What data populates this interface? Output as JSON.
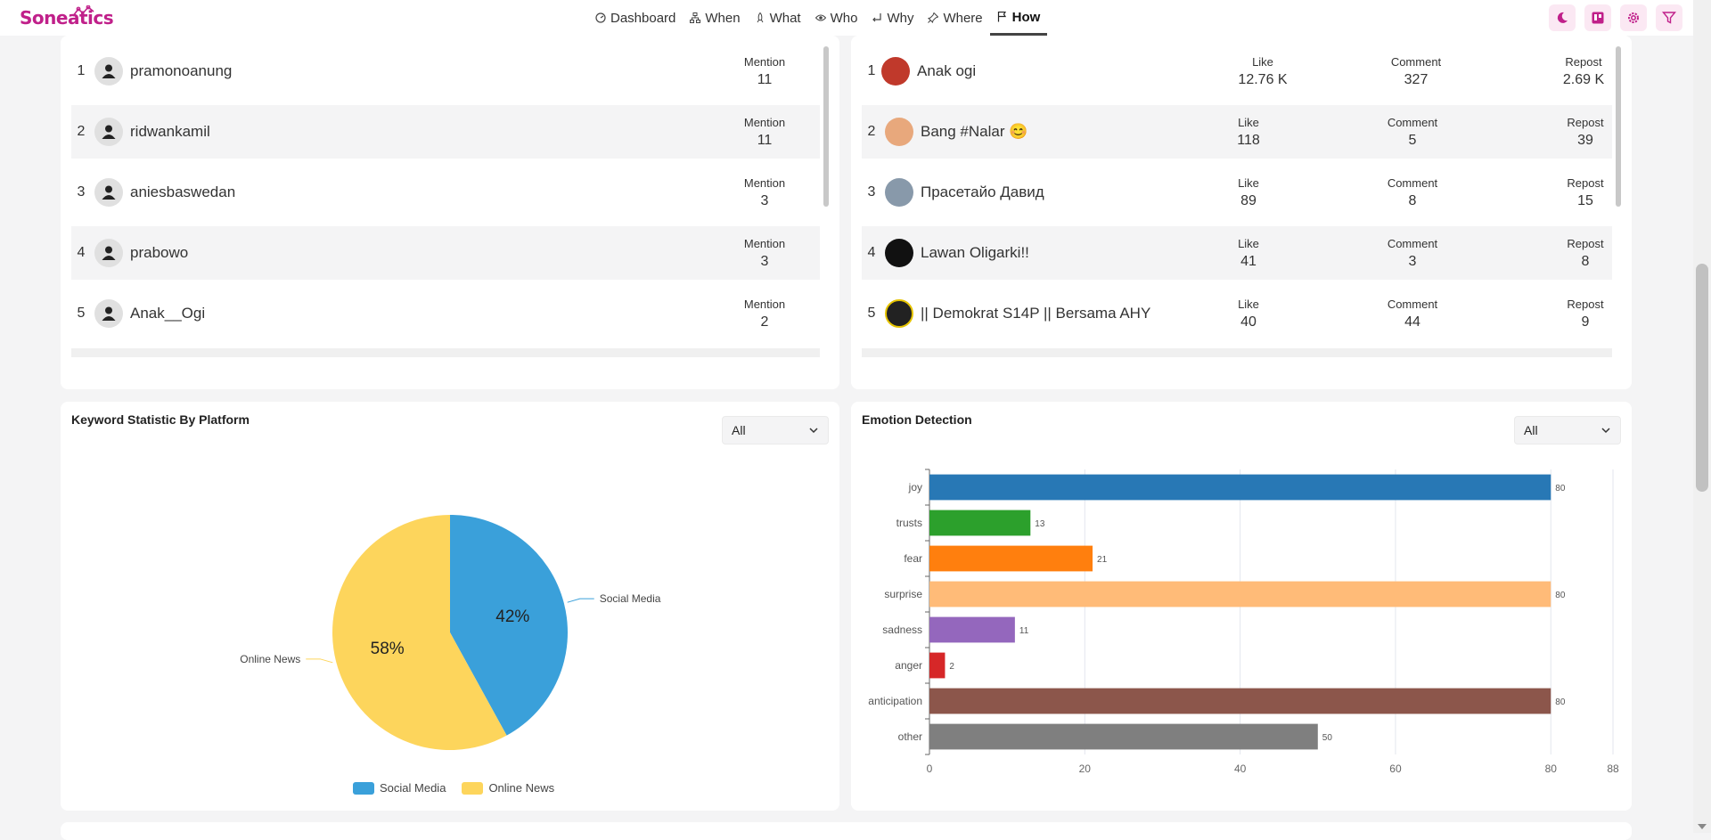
{
  "app": {
    "logo": "Soneatics"
  },
  "nav": {
    "items": [
      {
        "label": "Dashboard",
        "icon": "gauge-icon"
      },
      {
        "label": "When",
        "icon": "sitemap-icon"
      },
      {
        "label": "What",
        "icon": "rocket-icon"
      },
      {
        "label": "Who",
        "icon": "eye-icon"
      },
      {
        "label": "Why",
        "icon": "return-arrow-icon"
      },
      {
        "label": "Where",
        "icon": "pin-icon"
      },
      {
        "label": "How",
        "icon": "flag-icon"
      }
    ],
    "active": "How"
  },
  "toolbar": {
    "icons": [
      "moon-icon",
      "trello-icon",
      "gear-icon",
      "filter-icon"
    ]
  },
  "mentions": {
    "metric_label": "Mention",
    "rows": [
      {
        "rank": "1",
        "name": "pramonoanung",
        "value": "11"
      },
      {
        "rank": "2",
        "name": "ridwankamil",
        "value": "11"
      },
      {
        "rank": "3",
        "name": "aniesbaswedan",
        "value": "3"
      },
      {
        "rank": "4",
        "name": "prabowo",
        "value": "3"
      },
      {
        "rank": "5",
        "name": "Anak__Ogi",
        "value": "2"
      }
    ]
  },
  "engagement": {
    "labels": {
      "like": "Like",
      "comment": "Comment",
      "repost": "Repost"
    },
    "rows": [
      {
        "rank": "1",
        "name": "Anak ogi",
        "like": "12.76 K",
        "comment": "327",
        "repost": "2.69 K",
        "avatar_color": "#c0392b"
      },
      {
        "rank": "2",
        "name": "Bang #Nalar 😊",
        "like": "118",
        "comment": "5",
        "repost": "39",
        "avatar_color": "#e8a87c"
      },
      {
        "rank": "3",
        "name": "Прасетайо Давид",
        "like": "89",
        "comment": "8",
        "repost": "15",
        "avatar_color": "#8899aa"
      },
      {
        "rank": "4",
        "name": "Lawan Oligarki!!",
        "like": "41",
        "comment": "3",
        "repost": "8",
        "avatar_color": "#111111"
      },
      {
        "rank": "5",
        "name": "|| Demokrat S14P || Bersama AHY",
        "like": "40",
        "comment": "44",
        "repost": "9",
        "avatar_color": "#222222"
      }
    ]
  },
  "keyword_card": {
    "title": "Keyword Statistic By Platform",
    "select_value": "All"
  },
  "emotion_card": {
    "title": "Emotion Detection",
    "select_value": "All"
  },
  "chart_data": [
    {
      "type": "pie",
      "title": "",
      "slices": [
        {
          "name": "Social Media",
          "value": 42,
          "label": "42%",
          "color": "#3aa0da"
        },
        {
          "name": "Online News",
          "value": 58,
          "label": "58%",
          "color": "#fdd55c"
        }
      ],
      "legend": [
        "Social Media",
        "Online News"
      ],
      "legend_position": "bottom"
    },
    {
      "type": "bar",
      "orientation": "horizontal",
      "title": "",
      "categories": [
        "joy",
        "trusts",
        "fear",
        "surprise",
        "sadness",
        "anger",
        "anticipation",
        "other"
      ],
      "values": [
        80,
        13,
        21,
        80,
        11,
        2,
        80,
        50
      ],
      "colors": [
        "#2878b5",
        "#2ca02c",
        "#ff7f0e",
        "#ffbb78",
        "#9467bd",
        "#d62728",
        "#8c564b",
        "#7f7f7f"
      ],
      "xticks": [
        "0",
        "20",
        "40",
        "60",
        "80",
        "88"
      ],
      "xlim": [
        0,
        88
      ],
      "grid": true
    }
  ]
}
